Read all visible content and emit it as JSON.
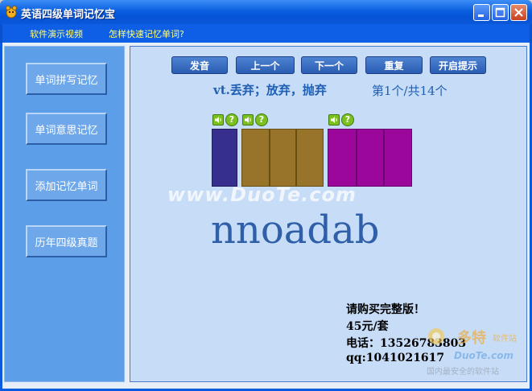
{
  "window": {
    "title": "英语四级单词记忆宝"
  },
  "menu": {
    "items": [
      "软件演示视频",
      "怎样快速记忆单词?"
    ]
  },
  "sidebar": {
    "items": [
      "单词拼写记忆",
      "单词意思记忆",
      "添加记忆单词",
      "历年四级真题"
    ]
  },
  "toolbar": {
    "buttons": [
      "发音",
      "上一个",
      "下一个",
      "重复",
      "开启提示"
    ]
  },
  "word": {
    "meaning": "vt.丢弃；放弃，抛弃",
    "counter": "第1个/共14个",
    "scrambled": "nnoadab"
  },
  "watermark": {
    "text": "www.DuoTe.com",
    "logo_name": "DuoTe.com",
    "logo_slogan": "国内最安全的软件站"
  },
  "purchase": {
    "line1": "请购买完整版！",
    "line2": "45元/套",
    "line3": "电话：13526783803",
    "line4": "qq:1041021617"
  },
  "colors": {
    "block_blue": "#372f8e",
    "block_brown": "#98742a",
    "block_purple": "#9a079a",
    "accent": "#0a5ae0"
  }
}
